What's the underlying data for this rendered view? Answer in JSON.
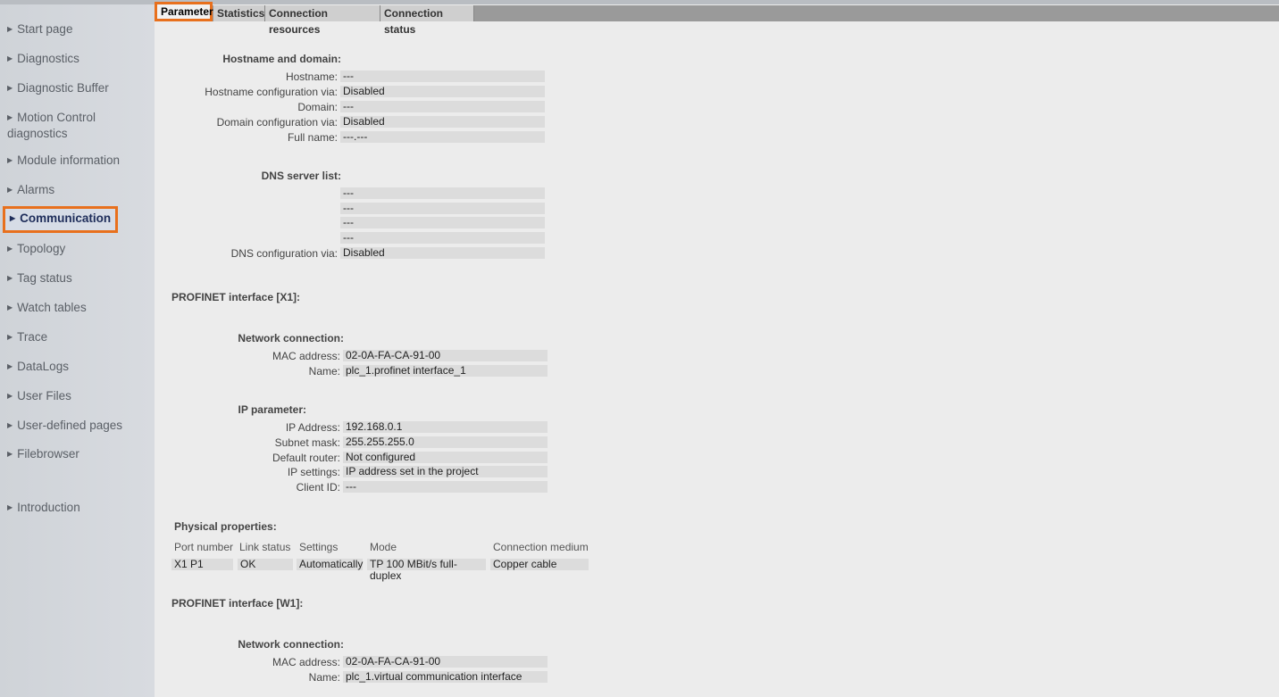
{
  "sidebar": {
    "items": [
      {
        "label": "Start page"
      },
      {
        "label": "Diagnostics"
      },
      {
        "label": "Diagnostic Buffer"
      },
      {
        "label": "Motion Control diagnostics"
      },
      {
        "label": "Module information"
      },
      {
        "label": "Alarms"
      },
      {
        "label": "Communication"
      },
      {
        "label": "Topology"
      },
      {
        "label": "Tag status"
      },
      {
        "label": "Watch tables"
      },
      {
        "label": "Trace"
      },
      {
        "label": "DataLogs"
      },
      {
        "label": "User Files"
      },
      {
        "label": "User-defined pages"
      },
      {
        "label": "Filebrowser"
      },
      {
        "label": "Introduction"
      }
    ]
  },
  "tabs": [
    {
      "label": "Parameter"
    },
    {
      "label": "Statistics"
    },
    {
      "label": "Connection resources"
    },
    {
      "label": "Connection status"
    }
  ],
  "hostname": {
    "header": "Hostname and domain:",
    "hostname_label": "Hostname:",
    "hostname_value": "---",
    "hostcfg_label": "Hostname configuration via:",
    "hostcfg_value": "Disabled",
    "domain_label": "Domain:",
    "domain_value": "---",
    "domaincfg_label": "Domain configuration via:",
    "domaincfg_value": "Disabled",
    "fullname_label": "Full name:",
    "fullname_value": "---.---"
  },
  "dns": {
    "header": "DNS server list:",
    "servers": [
      "---",
      "---",
      "---",
      "---"
    ],
    "cfg_label": "DNS configuration via:",
    "cfg_value": "Disabled"
  },
  "x1": {
    "title": "PROFINET interface [X1]:",
    "net_header": "Network connection:",
    "mac_label": "MAC address:",
    "mac_value": "02-0A-FA-CA-91-00",
    "name_label": "Name:",
    "name_value": "plc_1.profinet interface_1",
    "ip_header": "IP parameter:",
    "ip_label": "IP Address:",
    "ip_value": "192.168.0.1",
    "mask_label": "Subnet mask:",
    "mask_value": "255.255.255.0",
    "router_label": "Default router:",
    "router_value": "Not configured",
    "settings_label": "IP settings:",
    "settings_value": "IP address set in the project",
    "client_label": "Client ID:",
    "client_value": "---"
  },
  "physical": {
    "header": "Physical properties:",
    "columns": [
      "Port number",
      "Link status",
      "Settings",
      "Mode",
      "Connection medium"
    ],
    "row": [
      "X1 P1",
      "OK",
      "Automatically",
      "TP 100 MBit/s full-duplex",
      "Copper cable"
    ]
  },
  "w1": {
    "title": "PROFINET interface [W1]:",
    "net_header": "Network connection:",
    "mac_label": "MAC address:",
    "mac_value": "02-0A-FA-CA-91-00",
    "name_label": "Name:",
    "name_value": "plc_1.virtual communication interface"
  }
}
